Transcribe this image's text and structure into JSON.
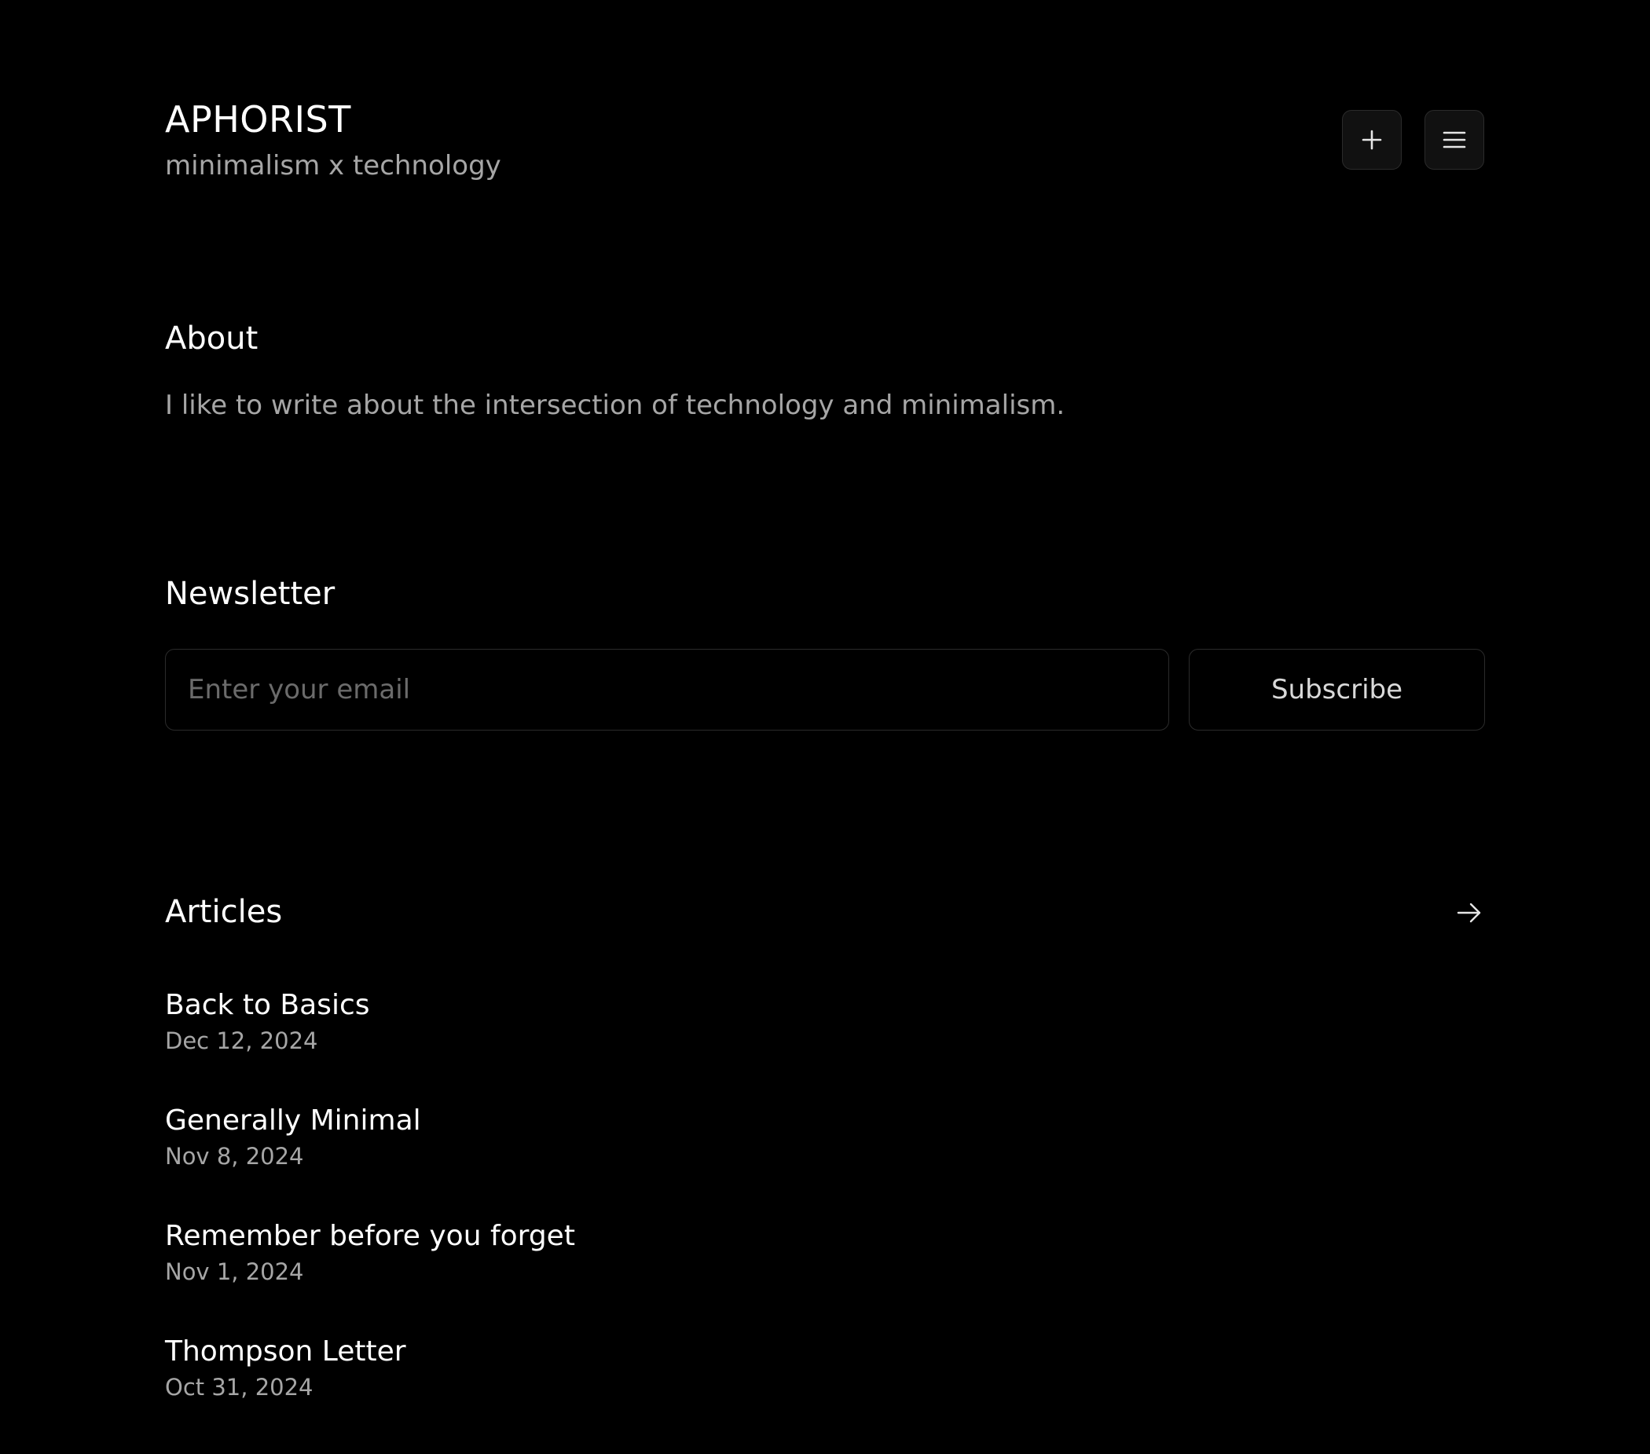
{
  "header": {
    "title": "APHORIST",
    "tagline": "minimalism x technology",
    "new_button_icon": "plus-icon",
    "menu_button_icon": "menu-icon"
  },
  "about": {
    "heading": "About",
    "text": "I like to write about the intersection of technology and minimalism."
  },
  "newsletter": {
    "heading": "Newsletter",
    "email_value": "",
    "email_placeholder": "Enter your email",
    "subscribe_label": "Subscribe"
  },
  "articles": {
    "heading": "Articles",
    "view_all_icon": "arrow-right-icon",
    "items": [
      {
        "title": "Back to Basics",
        "date": "Dec 12, 2024"
      },
      {
        "title": "Generally Minimal",
        "date": "Nov 8, 2024"
      },
      {
        "title": "Remember before you forget",
        "date": "Nov 1, 2024"
      },
      {
        "title": "Thompson Letter",
        "date": "Oct 31, 2024"
      }
    ]
  },
  "colors": {
    "background": "#000000",
    "text_primary": "#ffffff",
    "text_secondary": "#a6a6a6",
    "border": "#2b2b2b",
    "placeholder": "#6b6b6b"
  }
}
